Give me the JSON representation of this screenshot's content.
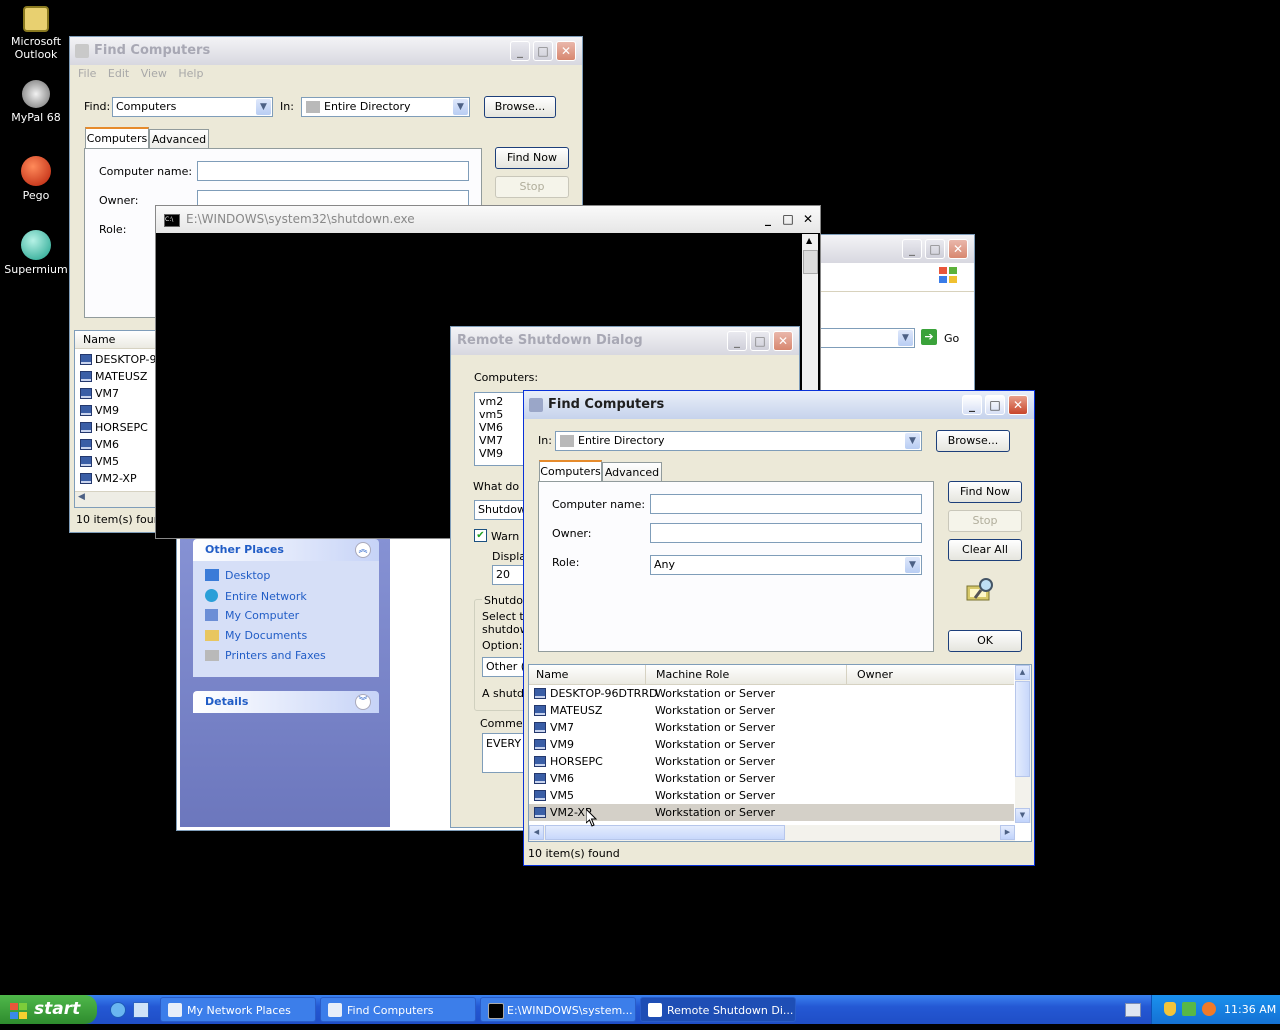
{
  "desktop": {
    "icons": [
      {
        "label": "Microsoft Outlook",
        "icon": "outlook-icon"
      },
      {
        "label": "MyPal 68",
        "icon": "mypal-icon"
      },
      {
        "label": "Pego",
        "icon": "pego-icon"
      },
      {
        "label": "Supermium",
        "icon": "supermium-icon"
      }
    ]
  },
  "find_back": {
    "title": "Find Computers",
    "menu": [
      "File",
      "Edit",
      "View",
      "Help"
    ],
    "find_label": "Find:",
    "find_value": "Computers",
    "in_label": "In:",
    "in_value": "Entire Directory",
    "browse": "Browse...",
    "tab_computers": "Computers",
    "tab_advanced": "Advanced",
    "computer_name_label": "Computer name:",
    "owner_label": "Owner:",
    "role_label": "Role:",
    "find_now": "Find Now",
    "stop": "Stop",
    "col_name": "Name",
    "rows": [
      "DESKTOP-96",
      "MATEUSZ",
      "VM7",
      "VM9",
      "HORSEPC",
      "VM6",
      "VM5",
      "VM2-XP"
    ],
    "status": "10 item(s) found"
  },
  "explorer": {
    "go": "Go",
    "other_places": "Other Places",
    "places": [
      "Desktop",
      "Entire Network",
      "My Computer",
      "My Documents",
      "Printers and Faxes"
    ],
    "details": "Details"
  },
  "cmd": {
    "title": "E:\\WINDOWS\\system32\\shutdown.exe"
  },
  "shutdown": {
    "title": "Remote Shutdown Dialog",
    "computers_label": "Computers:",
    "computers": [
      "vm2",
      "vm5",
      "VM6",
      "VM7",
      "VM9"
    ],
    "what_do": "What do y",
    "action_value": "Shutdown",
    "warn": "Warn",
    "display": "Displa",
    "display_value": "20",
    "shutdown_group": "Shutdow",
    "select_text": "Select th",
    "shutdown_text": "shutdow",
    "option_label": "Option:",
    "option_value": "Other (F",
    "a_shutdown": "A shutdo",
    "comment_label": "Commen",
    "comment_value": "EVERY"
  },
  "find_front": {
    "title": "Find Computers",
    "in_label": "In:",
    "in_value": "Entire Directory",
    "browse": "Browse...",
    "tab_computers": "Computers",
    "tab_advanced": "Advanced",
    "computer_name_label": "Computer name:",
    "owner_label": "Owner:",
    "role_label": "Role:",
    "role_value": "Any",
    "find_now": "Find Now",
    "stop": "Stop",
    "clear_all": "Clear All",
    "ok": "OK",
    "columns": [
      "Name",
      "Machine Role",
      "Owner"
    ],
    "rows": [
      {
        "name": "DESKTOP-96DTRRD",
        "role": "Workstation or Server"
      },
      {
        "name": "MATEUSZ",
        "role": "Workstation or Server"
      },
      {
        "name": "VM7",
        "role": "Workstation or Server"
      },
      {
        "name": "VM9",
        "role": "Workstation or Server"
      },
      {
        "name": "HORSEPC",
        "role": "Workstation or Server"
      },
      {
        "name": "VM6",
        "role": "Workstation or Server"
      },
      {
        "name": "VM5",
        "role": "Workstation or Server"
      },
      {
        "name": "VM2-XP",
        "role": "Workstation or Server"
      }
    ],
    "status": "10 item(s) found"
  },
  "taskbar": {
    "start": "start",
    "tasks": [
      "My Network Places",
      "Find Computers",
      "E:\\WINDOWS\\system...",
      "Remote Shutdown Di..."
    ],
    "clock": "11:36 AM"
  }
}
